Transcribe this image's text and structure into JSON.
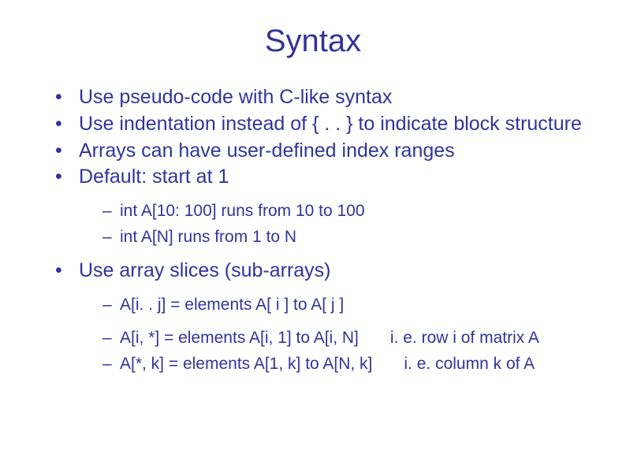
{
  "title": "Syntax",
  "bullets": {
    "b1": "Use pseudo-code with C-like syntax",
    "b2": "Use indentation instead of { . . }  to indicate block structure",
    "b3": "Arrays can have user-defined index ranges",
    "b4": "Default: start at 1",
    "b5": "Use array slices (sub-arrays)"
  },
  "sub1": {
    "s1": "int A[10: 100]   runs from 10 to 100",
    "s2": "int A[N]             runs from 1 to N"
  },
  "sub2": {
    "s1": "A[i. . j] = elements A[ i ] to A[ j ]",
    "s2_left": "A[i, *] = elements A[i, 1] to A[i, N]",
    "s2_right": "i. e. row i of matrix A",
    "s3_left": "A[*, k] = elements A[1, k] to A[N, k]",
    "s3_right": "i. e. column k of A"
  }
}
